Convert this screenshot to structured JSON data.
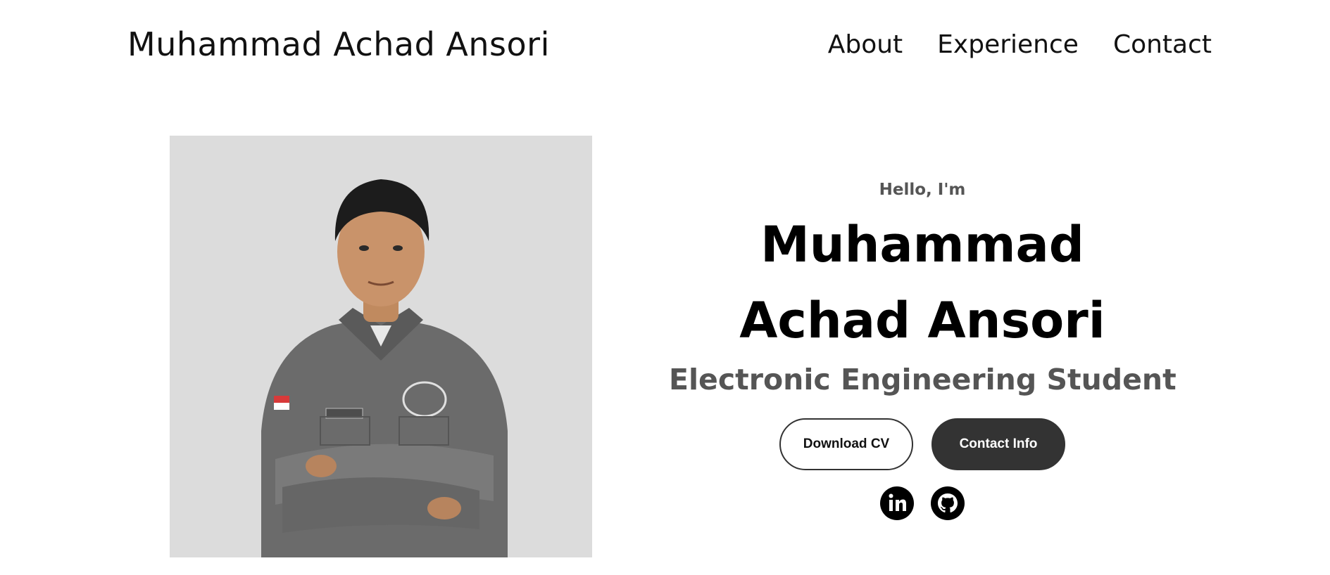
{
  "header": {
    "logo": "Muhammad Achad Ansori",
    "nav": [
      {
        "label": "About"
      },
      {
        "label": "Experience"
      },
      {
        "label": "Contact"
      }
    ]
  },
  "hero": {
    "greeting": "Hello, I'm",
    "name_line1": "Muhammad",
    "name_line2": "Achad Ansori",
    "title": "Electronic Engineering Student",
    "buttons": {
      "download_cv": "Download CV",
      "contact_info": "Contact Info"
    },
    "socials": [
      {
        "icon": "linkedin-icon"
      },
      {
        "icon": "github-icon"
      }
    ]
  },
  "colors": {
    "text": "#000000",
    "muted_text": "#555555",
    "dark_button": "#333333",
    "photo_bg": "#dcdcdc",
    "background": "#ffffff"
  }
}
